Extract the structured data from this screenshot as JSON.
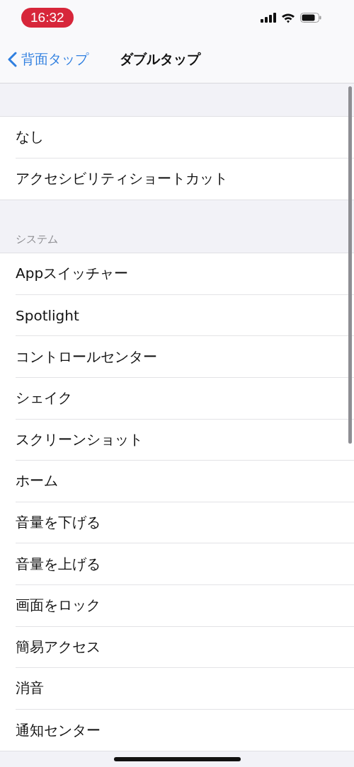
{
  "status_bar": {
    "time": "16:32"
  },
  "nav": {
    "back": "背面タップ",
    "title": "ダブルタップ"
  },
  "sections": [
    {
      "items": [
        "なし",
        "アクセシビリティショートカット"
      ]
    },
    {
      "header": "システム",
      "items": [
        "Appスイッチャー",
        "Spotlight",
        "コントロールセンター",
        "シェイク",
        "スクリーンショット",
        "ホーム",
        "音量を下げる",
        "音量を上げる",
        "画面をロック",
        "簡易アクセス",
        "消音",
        "通知センター"
      ]
    }
  ]
}
